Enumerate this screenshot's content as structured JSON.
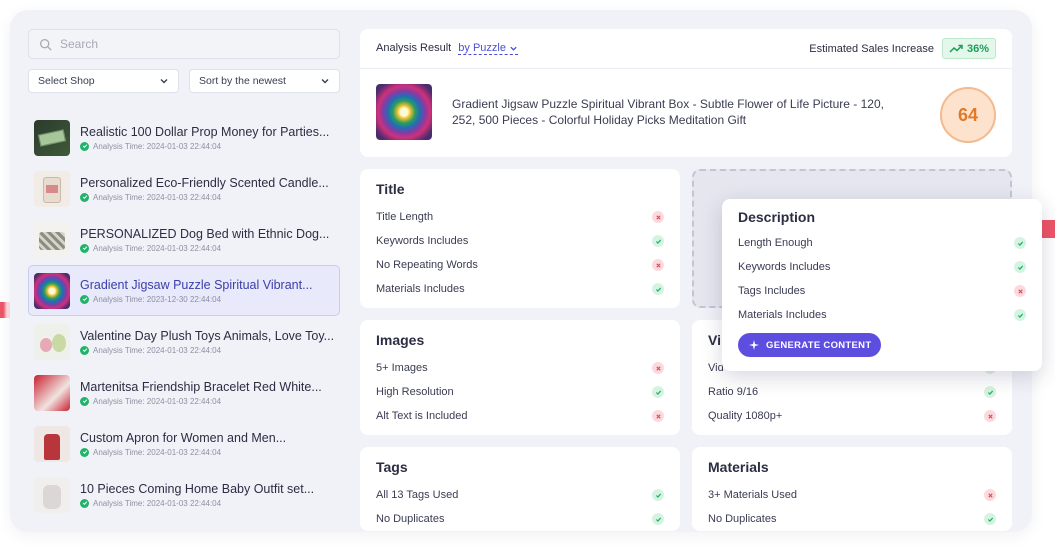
{
  "search": {
    "placeholder": "Search"
  },
  "filters": {
    "shop_label": "Select Shop",
    "sort_label": "Sort by the newest"
  },
  "listings": [
    {
      "title": "Realistic 100 Dollar Prop Money for Parties...",
      "meta": "Analysis Time: 2024-01-03 22:44:04"
    },
    {
      "title": "Personalized Eco-Friendly Scented Candle...",
      "meta": "Analysis Time: 2024-01-03 22:44:04"
    },
    {
      "title": "PERSONALIZED Dog Bed with Ethnic Dog...",
      "meta": "Analysis Time: 2024-01-03 22:44:04"
    },
    {
      "title": "Gradient Jigsaw Puzzle Spiritual Vibrant...",
      "meta": "Analysis Time: 2023-12-30 22:44:04"
    },
    {
      "title": "Valentine Day Plush Toys Animals, Love Toy...",
      "meta": "Analysis Time: 2024-01-03 22:44:04"
    },
    {
      "title": "Martenitsa Friendship Bracelet Red White...",
      "meta": "Analysis Time: 2024-01-03 22:44:04"
    },
    {
      "title": "Custom Apron for Women and Men...",
      "meta": "Analysis Time: 2024-01-03 22:44:04"
    },
    {
      "title": "10 Pieces Coming Home Baby Outfit set...",
      "meta": "Analysis Time: 2024-01-03 22:44:04"
    }
  ],
  "result": {
    "label": "Analysis Result",
    "by": "by Puzzle",
    "sales_label": "Estimated Sales Increase",
    "sales_value": "36%",
    "product_title": "Gradient Jigsaw Puzzle Spiritual Vibrant Box - Subtle Flower of Life Picture - 120, 252, 500 Pieces - Colorful Holiday Picks Meditation Gift",
    "score": "64"
  },
  "title_card": {
    "heading": "Title",
    "rows": [
      {
        "label": "Title Length",
        "status": "bad"
      },
      {
        "label": "Keywords Includes",
        "status": "ok"
      },
      {
        "label": "No Repeating Words",
        "status": "bad"
      },
      {
        "label": "Materials Includes",
        "status": "ok"
      }
    ]
  },
  "images_card": {
    "heading": "Images",
    "rows": [
      {
        "label": "5+ Images",
        "status": "bad"
      },
      {
        "label": "High Resolution",
        "status": "ok"
      },
      {
        "label": "Alt Text is Included",
        "status": "bad"
      }
    ]
  },
  "video_card": {
    "heading": "Vi",
    "rows": [
      {
        "label": "Vid",
        "status": "ok"
      },
      {
        "label": "Ratio 9/16",
        "status": "ok"
      },
      {
        "label": "Quality 1080p+",
        "status": "bad"
      }
    ]
  },
  "tags_card": {
    "heading": "Tags",
    "rows": [
      {
        "label": "All 13 Tags Used",
        "status": "ok"
      },
      {
        "label": "No Duplicates",
        "status": "ok"
      }
    ]
  },
  "materials_card": {
    "heading": "Materials",
    "rows": [
      {
        "label": "3+ Materials Used",
        "status": "bad"
      },
      {
        "label": "No Duplicates",
        "status": "ok"
      }
    ]
  },
  "description_card": {
    "heading": "Description",
    "rows": [
      {
        "label": "Length Enough",
        "status": "ok"
      },
      {
        "label": "Keywords Includes",
        "status": "ok"
      },
      {
        "label": "Tags Includes",
        "status": "bad"
      },
      {
        "label": "Materials Includes",
        "status": "ok"
      }
    ],
    "button": "GENERATE CONTENT"
  },
  "colors": {
    "accent": "#5d4ee0",
    "ok": "#22b36b",
    "bad": "#e0475a",
    "score": "#e07a2b"
  }
}
